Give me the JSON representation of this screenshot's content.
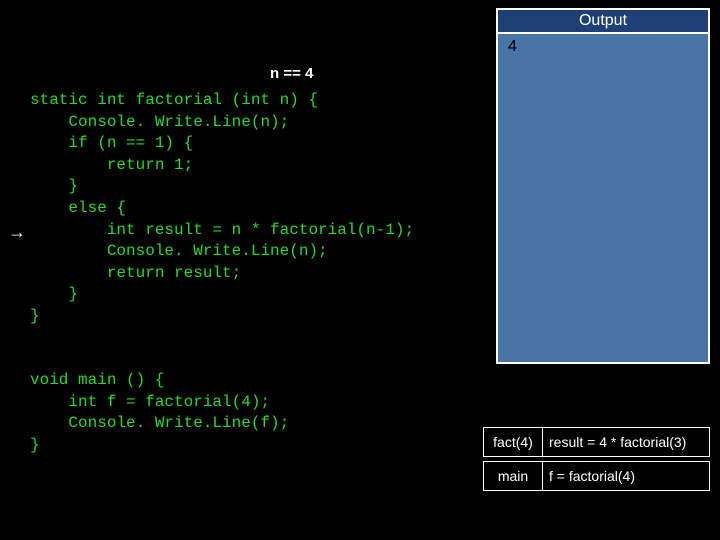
{
  "output": {
    "title": "Output",
    "lines": [
      "4"
    ]
  },
  "state": {
    "n_label": "n == 4"
  },
  "code": {
    "factorial": "static int factorial (int n) {\n    Console. Write.Line(n);\n    if (n == 1) {\n        return 1;\n    }\n    else {\n        int result = n * factorial(n-1);\n        Console. Write.Line(n);\n        return result;\n    }\n}",
    "main": "void main () {\n    int f = factorial(4);\n    Console. Write.Line(f);\n}"
  },
  "stack": [
    {
      "frame": "fact(4)",
      "expr": "result = 4 * factorial(3)"
    },
    {
      "frame": "main",
      "expr": "f = factorial(4)"
    }
  ]
}
